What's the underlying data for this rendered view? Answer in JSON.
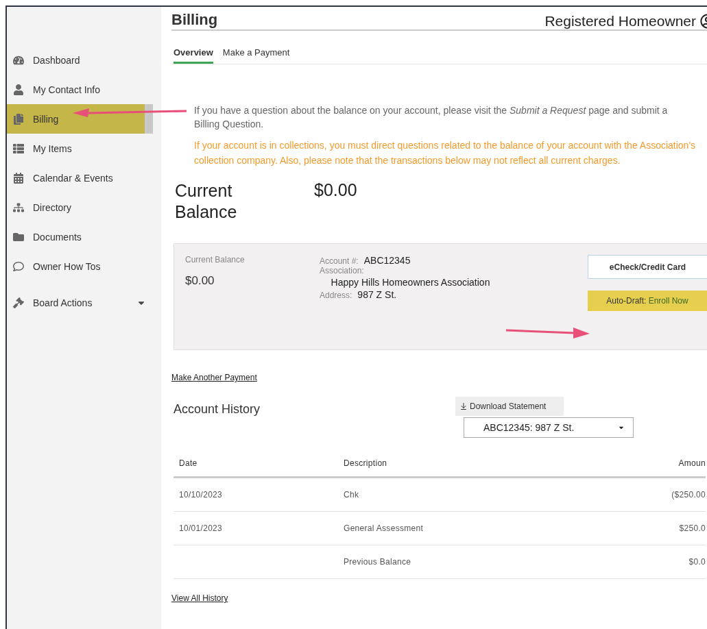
{
  "header": {
    "title": "Billing",
    "user_label": "Registered Homeowner"
  },
  "sidebar": {
    "items": [
      {
        "label": "Dashboard",
        "kind": "link",
        "selected": false
      },
      {
        "label": "My Contact Info",
        "kind": "link",
        "selected": false
      },
      {
        "label": "Billing",
        "kind": "link",
        "selected": true
      },
      {
        "label": "My Items",
        "kind": "link",
        "selected": false
      },
      {
        "label": "Calendar & Events",
        "kind": "link",
        "selected": false
      },
      {
        "label": "Directory",
        "kind": "link",
        "selected": false
      },
      {
        "label": "Documents",
        "kind": "link",
        "selected": false
      },
      {
        "label": "Owner How Tos",
        "kind": "link",
        "selected": false
      },
      {
        "label": "Board Actions",
        "kind": "menu",
        "selected": false
      }
    ]
  },
  "tabs": [
    {
      "label": "Overview",
      "selected": true
    },
    {
      "label": "Make a Payment",
      "selected": false
    }
  ],
  "notice": {
    "info": "If you have a question about the balance on your account, please visit the *Submit a Request* page and submit a Billing Question.",
    "warning": "If your account is in collections, you must direct questions related to the balance of your account with the Association's collection company. Also, please note that the transactions below may not reflect all current charges."
  },
  "balance_summary": {
    "label": "Current Balance",
    "amount": "$0.00"
  },
  "account_card": {
    "balance_label": "Current Balance",
    "balance": "$0.00",
    "fields": [
      {
        "label": "Account #:",
        "value": "ABC12345",
        "kind": "inline"
      },
      {
        "label": "Association:",
        "value": "Happy Hills Homeowners Association",
        "kind": "block"
      },
      {
        "label": "Address:",
        "value": "987 Z St.",
        "kind": "inline"
      }
    ],
    "buttons": [
      {
        "kind": "outline",
        "label": "eCheck/Credit Card"
      },
      {
        "kind": "autodraft",
        "label": "Auto-Draft:",
        "action": "Enroll Now"
      }
    ]
  },
  "make_another_payment": "Make Another Payment",
  "history": {
    "title": "Account History",
    "download": "Download Statement",
    "account_select": "ABC12345: 987 Z St.",
    "columns": [
      "Date",
      "Description",
      "Amoun"
    ],
    "rows": [
      [
        "10/10/2023",
        "Chk",
        "($250.00"
      ],
      [
        "10/01/2023",
        "General Assessment",
        "$250.0"
      ],
      [
        "",
        "Previous Balance",
        "$0.0"
      ]
    ],
    "view_all": "View All History"
  }
}
